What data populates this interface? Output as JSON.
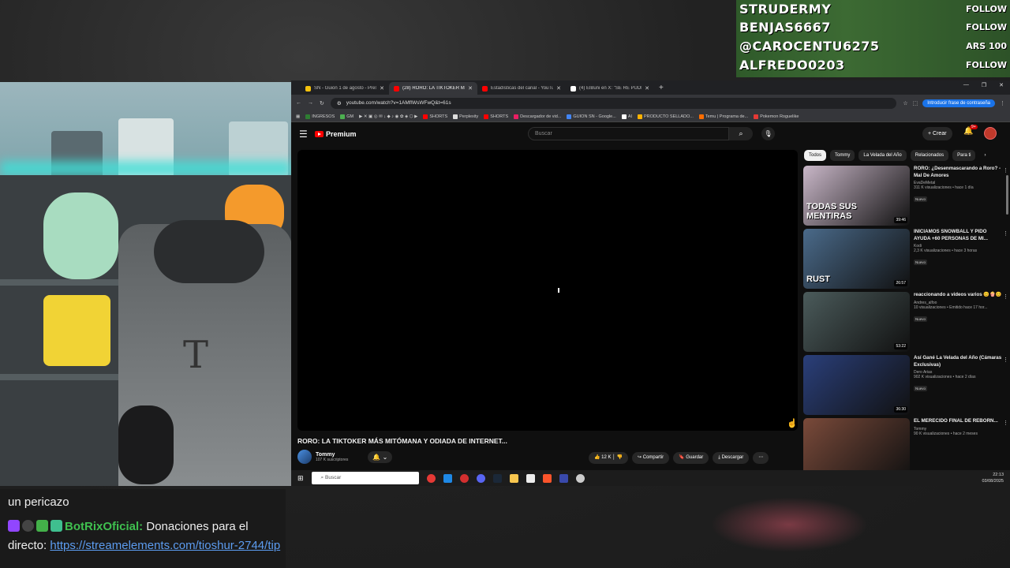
{
  "alerts": [
    {
      "name": "STRUDERMY",
      "tag": "FOLLOW"
    },
    {
      "name": "BENJAS6667",
      "tag": "FOLLOW"
    },
    {
      "name": "@CAROCENTU6275",
      "tag": "ARS 100"
    },
    {
      "name": "ALFREDO0203",
      "tag": "FOLLOW"
    }
  ],
  "browser": {
    "tabs": [
      {
        "label": "SN - Guion 1 de agosto - Pres...",
        "color": "#f4c20d"
      },
      {
        "label": "(28) RORO: LA TIKTOKER MÁS ...",
        "color": "#ff0000"
      },
      {
        "label": "Estadísticas del canal - YouTube",
        "color": "#ff0000"
      },
      {
        "label": "(4) ElBuni en X: \"SE RE PUDRIÓ...",
        "color": "#ffffff"
      }
    ],
    "url": "youtube.com/watch?v=1AMflWsWFwQ&t=61s",
    "password_btn": "Introducir frase de contraseña",
    "bookmarks": [
      "INGRESOS",
      "GM",
      "SHORTS",
      "Perplexity",
      "SHORTS",
      "Descargador de vid...",
      "GUION SN - Google...",
      "AI",
      "PRODUCTO SELLADO...",
      "Temu | Programa de...",
      "Pokemon Roguelike"
    ]
  },
  "yt": {
    "logo": "Premium",
    "search_placeholder": "Buscar",
    "crear": "Crear",
    "notif_count": "9+",
    "video_title": "RORO: LA TIKTOKER MÁS MITÓMANA Y ODIADA DE INTERNET...",
    "channel": "Tommy",
    "subs": "107 K suscriptores",
    "likes": "12 K",
    "share": "Compartir",
    "save": "Guardar",
    "download": "Descargar",
    "chips": [
      "Todos",
      "Tommy",
      "La Velada del Año",
      "Relacionados",
      "Para ti"
    ],
    "recs": [
      {
        "title": "RORO: ¿Desenmascarando a Roro? - Mal De Amores",
        "channel": "EvaDeMetal",
        "views": "311 K visualizaciones • hace 1 día",
        "badge": "Nuevo",
        "dur": "39:46",
        "thumb": "#c9b7c8",
        "thumb_text": "TODAS SUS MENTIRAS"
      },
      {
        "title": "INICIAMOS SNOWBALL Y PIDO AYUDA +60 PERSONAS DE MI...",
        "channel": "Kodi",
        "views": "2,3 K visualizaciones • hace 3 horas",
        "badge": "Nuevo",
        "dur": "26:57",
        "thumb": "#4a6a8a",
        "thumb_text": "RUST"
      },
      {
        "title": "reaccionando a videos varios 😊🍿😊",
        "channel": "Andres_alfoo",
        "views": "10 visualizaciones • Emitido hace 17 hor...",
        "badge": "Nuevo",
        "dur": "53:22",
        "thumb": "#4b5b5b",
        "thumb_text": ""
      },
      {
        "title": "Así Gané La Velada del Año (Cámaras Exclusivas)",
        "channel": "Dero Arias",
        "views": "902 K visualizaciones • hace 2 días",
        "badge": "Nuevo",
        "dur": "36:30",
        "thumb": "#2a3f7a",
        "thumb_text": ""
      },
      {
        "title": "EL MERECIDO FINAL DE REBORN...",
        "channel": "Tommy",
        "views": "90 K visualizaciones • hace 2 meses",
        "badge": "",
        "dur": "",
        "thumb": "#7a4a3a",
        "thumb_text": ""
      }
    ]
  },
  "taskbar": {
    "search": "Buscar",
    "time": "22:13",
    "date": "03/08/2025"
  },
  "chat": {
    "line1": "un pericazo",
    "bot_name": "BotRixOficial:",
    "message": " Donaciones para el directo: ",
    "link": "https://streamelements.com/tioshur-2744/tip"
  }
}
